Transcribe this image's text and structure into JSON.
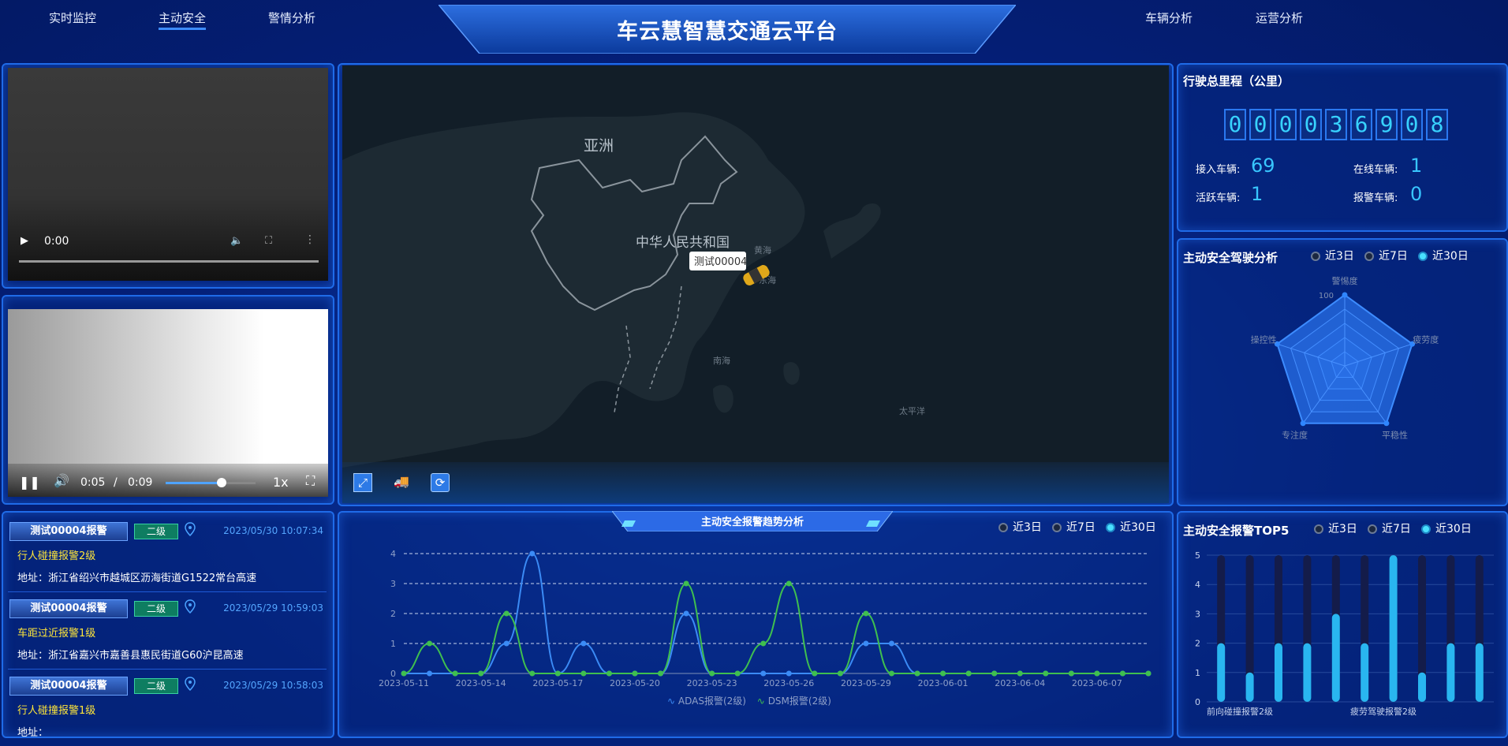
{
  "header": {
    "title": "车云慧智慧交通云平台",
    "nav_left": [
      "实时监控",
      "主动安全",
      "警情分析"
    ],
    "nav_right": [
      "车辆分析",
      "运营分析"
    ],
    "active": "主动安全"
  },
  "video1": {
    "time": "0:00"
  },
  "video2": {
    "current": "0:05",
    "sep": "/",
    "duration": "0:09",
    "speed": "1x",
    "progress": 0.62
  },
  "map": {
    "labels": {
      "asia": "亚洲",
      "china": "中华人民共和国",
      "yellow_sea": "黄海",
      "east_sea": "东海",
      "south_sea": "南海",
      "pacific": "太平洋"
    },
    "vehicle_tooltip": "测试00004"
  },
  "alerts": [
    {
      "tag": "测试00004报警",
      "level": "二级",
      "time": "2023/05/30 10:07:34",
      "name": "行人碰撞报警2级",
      "address": "地址：浙江省绍兴市越城区沥海街道G1522常台高速"
    },
    {
      "tag": "测试00004报警",
      "level": "二级",
      "time": "2023/05/29 10:59:03",
      "name": "车距过近报警1级",
      "address": "地址：浙江省嘉兴市嘉善县惠民街道G60沪昆高速"
    },
    {
      "tag": "测试00004报警",
      "level": "二级",
      "time": "2023/05/29 10:58:03",
      "name": "行人碰撞报警1级",
      "address": "地址："
    }
  ],
  "mileage": {
    "title": "行驶总里程（公里）",
    "digits": [
      "0",
      "0",
      "0",
      "0",
      "3",
      "6",
      "9",
      "0",
      "8"
    ],
    "connected_label": "接入车辆:",
    "connected": "69",
    "online_label": "在线车辆:",
    "online": "1",
    "active_label": "活跃车辆:",
    "active": "1",
    "alarm_label": "报警车辆:",
    "alarm": "0"
  },
  "range_options": [
    "近3日",
    "近7日",
    "近30日"
  ],
  "radar": {
    "title": "主动安全驾驶分析",
    "axes": [
      "警惕度",
      "疲劳度",
      "平稳性",
      "专注度",
      "操控性"
    ],
    "max_label": "100",
    "values": [
      100,
      100,
      100,
      100,
      100
    ]
  },
  "trend": {
    "title": "主动安全报警趋势分析",
    "chart_data": {
      "type": "line",
      "x": [
        "2023-05-11",
        "2023-05-12",
        "2023-05-13",
        "2023-05-14",
        "2023-05-15",
        "2023-05-16",
        "2023-05-17",
        "2023-05-18",
        "2023-05-19",
        "2023-05-20",
        "2023-05-21",
        "2023-05-22",
        "2023-05-23",
        "2023-05-24",
        "2023-05-25",
        "2023-05-26",
        "2023-05-27",
        "2023-05-28",
        "2023-05-29",
        "2023-05-30",
        "2023-05-31",
        "2023-06-01",
        "2023-06-02",
        "2023-06-03",
        "2023-06-04",
        "2023-06-05",
        "2023-06-06",
        "2023-06-07",
        "2023-06-08",
        "2023-06-09"
      ],
      "tick_labels": [
        "2023-05-11",
        "2023-05-14",
        "2023-05-17",
        "2023-05-20",
        "2023-05-23",
        "2023-05-26",
        "2023-05-29",
        "2023-06-01",
        "2023-06-04",
        "2023-06-07"
      ],
      "series": [
        {
          "name": "ADAS报警(2级)",
          "color": "#3b8bf5",
          "values": [
            0,
            0,
            0,
            0,
            1,
            4,
            0,
            1,
            0,
            0,
            0,
            2,
            0,
            0,
            0,
            0,
            0,
            0,
            1,
            1,
            0,
            0,
            0,
            0,
            0,
            0,
            0,
            0,
            0,
            0
          ]
        },
        {
          "name": "DSM报警(2级)",
          "color": "#3fbf4f",
          "values": [
            0,
            1,
            0,
            0,
            2,
            0,
            0,
            0,
            0,
            0,
            0,
            3,
            0,
            0,
            1,
            3,
            0,
            0,
            2,
            0,
            0,
            0,
            0,
            0,
            0,
            0,
            0,
            0,
            0,
            0
          ]
        }
      ],
      "ylim": [
        0,
        4
      ],
      "yticks": [
        0,
        1,
        2,
        3,
        4
      ],
      "grid": true,
      "legend": "bottom"
    }
  },
  "top5": {
    "title": "主动安全报警TOP5",
    "chart_data": {
      "type": "bar",
      "categories": [
        "前向碰撞报警2级",
        "",
        "",
        "",
        "",
        "疲劳驾驶报警2级",
        "",
        "",
        "",
        ""
      ],
      "series": [
        {
          "name": "",
          "values": [
            2,
            1,
            2,
            2,
            3,
            2,
            5,
            1,
            2,
            2
          ],
          "color": "#29b6f0"
        }
      ],
      "ylim": [
        0,
        5
      ],
      "yticks": [
        0,
        1,
        2,
        3,
        4,
        5
      ]
    }
  }
}
